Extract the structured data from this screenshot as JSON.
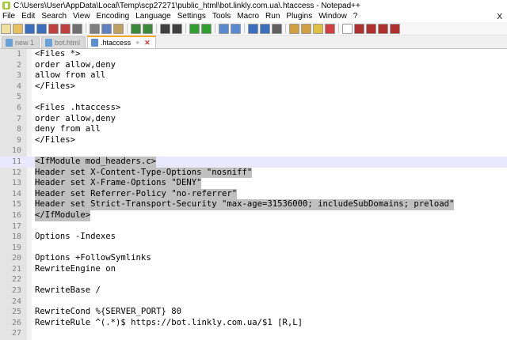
{
  "window": {
    "title": "C:\\Users\\User\\AppData\\Local\\Temp\\scp27271\\public_html\\bot.linkly.com.ua\\.htaccess - Notepad++"
  },
  "menu": [
    "File",
    "Edit",
    "Search",
    "View",
    "Encoding",
    "Language",
    "Settings",
    "Tools",
    "Macro",
    "Run",
    "Plugins",
    "Window",
    "?"
  ],
  "menu_close": "X",
  "tabs": [
    {
      "label": "new 1",
      "active": false
    },
    {
      "label": "bot.html",
      "active": false
    },
    {
      "label": ".htaccess",
      "active": true
    }
  ],
  "editor": {
    "current_line": 11,
    "selection_lines": [
      11,
      12,
      13,
      14,
      15,
      16
    ],
    "lines": [
      "<Files *>",
      "order allow,deny",
      "allow from all",
      "</Files>",
      "",
      "<Files .htaccess>",
      "order allow,deny",
      "deny from all",
      "</Files>",
      "",
      "<IfModule mod_headers.c>",
      "Header set X-Content-Type-Options \"nosniff\"",
      "Header set X-Frame-Options \"DENY\"",
      "Header set Referrer-Policy \"no-referrer\"",
      "Header set Strict-Transport-Security \"max-age=31536000; includeSubDomains; preload\"",
      "</IfModule>",
      "",
      "Options -Indexes",
      "",
      "Options +FollowSymlinks",
      "RewriteEngine on",
      "",
      "RewriteBase /",
      "",
      "RewriteCond %{SERVER_PORT} 80",
      "RewriteRule ^(.*)$ https://bot.linkly.com.ua/$1 [R,L]",
      ""
    ]
  },
  "toolbar_icons": [
    "new-file-icon",
    "open-file-icon",
    "save-icon",
    "save-all-icon",
    "close-icon",
    "close-all-icon",
    "print-icon",
    "cut-icon",
    "copy-icon",
    "paste-icon",
    "undo-icon",
    "redo-icon",
    "find-icon",
    "replace-icon",
    "zoom-in-icon",
    "zoom-out-icon",
    "sync-v-icon",
    "sync-h-icon",
    "word-wrap-icon",
    "all-chars-icon",
    "indent-guide-icon",
    "doc-map-icon",
    "function-list-icon",
    "folder-as-workspace-icon",
    "monitoring-icon",
    "record-macro-icon",
    "stop-macro-icon",
    "play-macro-icon",
    "run-macro-multiple-icon",
    "save-macro-icon"
  ]
}
